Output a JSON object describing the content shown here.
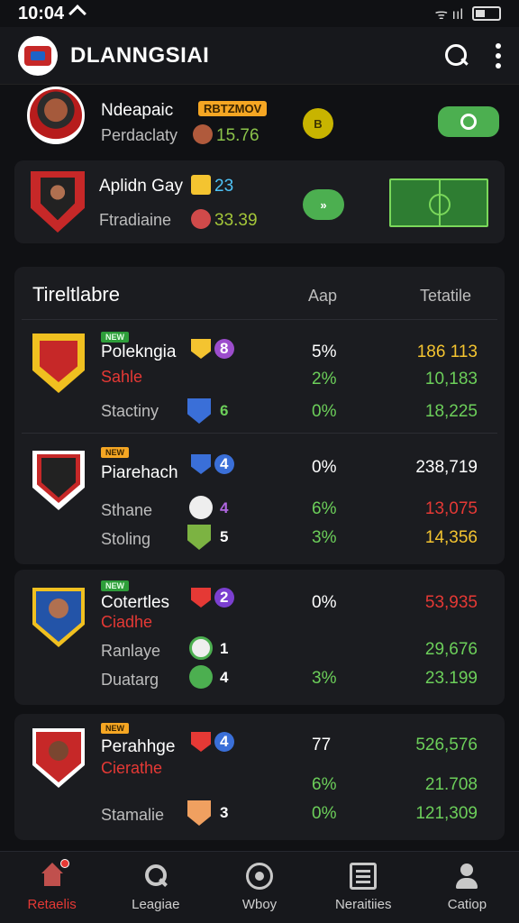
{
  "status": {
    "time": "10:04",
    "signal_text": "ᯤ ııl"
  },
  "app": {
    "title": "DLANNGSIAI"
  },
  "hero": [
    {
      "name": "Ndeapaic",
      "badge": "RBTZMOV",
      "sub": "Perdaclaty",
      "value": "15.76",
      "coin": "B"
    },
    {
      "name": "Aplidn Gay",
      "value_top": "23",
      "sub": "Ftradiaine",
      "value": "33.39",
      "button": "»"
    }
  ],
  "table": {
    "title": "Tireltlabre",
    "col_app": "Aap",
    "col_total": "Tetatile",
    "groups": [
      {
        "tag": "NEW",
        "tag_color": "green",
        "name": "Polekngia",
        "red_label": "Sahle",
        "name_num": "8",
        "rows": [
          {
            "label": "Stactiny",
            "num": "6",
            "pct": "2%",
            "total": "10,183"
          }
        ],
        "pct_top": "5%",
        "total_top": "186 113",
        "pct_bottom": "0%",
        "total_bottom": "18,225"
      },
      {
        "tag": "NEW",
        "tag_color": "orange",
        "name": "Piarehach",
        "name_num": "4",
        "pct_top": "0%",
        "total_top": "238,719",
        "rows": [
          {
            "label": "Sthane",
            "num": "4",
            "pct": "6%",
            "total": "13,075"
          },
          {
            "label": "Stoling",
            "num": "5",
            "pct": "3%",
            "total": "14,356"
          }
        ]
      }
    ]
  },
  "groups": [
    {
      "tag": "NEW",
      "tag_color": "green",
      "name": "Cotertles",
      "red_label": "Ciadhe",
      "name_num": "2",
      "pct_top": "0%",
      "total_top": "53,935",
      "rows": [
        {
          "label": "Ranlaye",
          "num": "1",
          "pct": "",
          "total": "29,676"
        },
        {
          "label": "Duatarg",
          "num": "4",
          "pct": "3%",
          "total": "23.199"
        }
      ]
    },
    {
      "tag": "NEW",
      "tag_color": "orange",
      "name": "Perahhge",
      "red_label": "Cierathe",
      "name_num": "4",
      "pct_top": "77",
      "total_top": "526,576",
      "rows": [
        {
          "label": "",
          "num": "",
          "pct": "6%",
          "total": "21.708"
        },
        {
          "label": "Stamalie",
          "num": "3",
          "pct": "0%",
          "total": "121,309"
        }
      ]
    }
  ],
  "nav": [
    {
      "label": "Retaelis",
      "icon": "home-icon",
      "active": true
    },
    {
      "label": "Leagiae",
      "icon": "magnify-icon",
      "active": false
    },
    {
      "label": "Wboy",
      "icon": "ball-icon",
      "active": false
    },
    {
      "label": "Neraitiies",
      "icon": "news-icon",
      "active": false
    },
    {
      "label": "Catiop",
      "icon": "user-icon",
      "active": false
    }
  ],
  "colors": {
    "accent_red": "#e53935",
    "accent_green": "#6ccf5a",
    "accent_yellow": "#f4c430",
    "background": "#101114"
  }
}
